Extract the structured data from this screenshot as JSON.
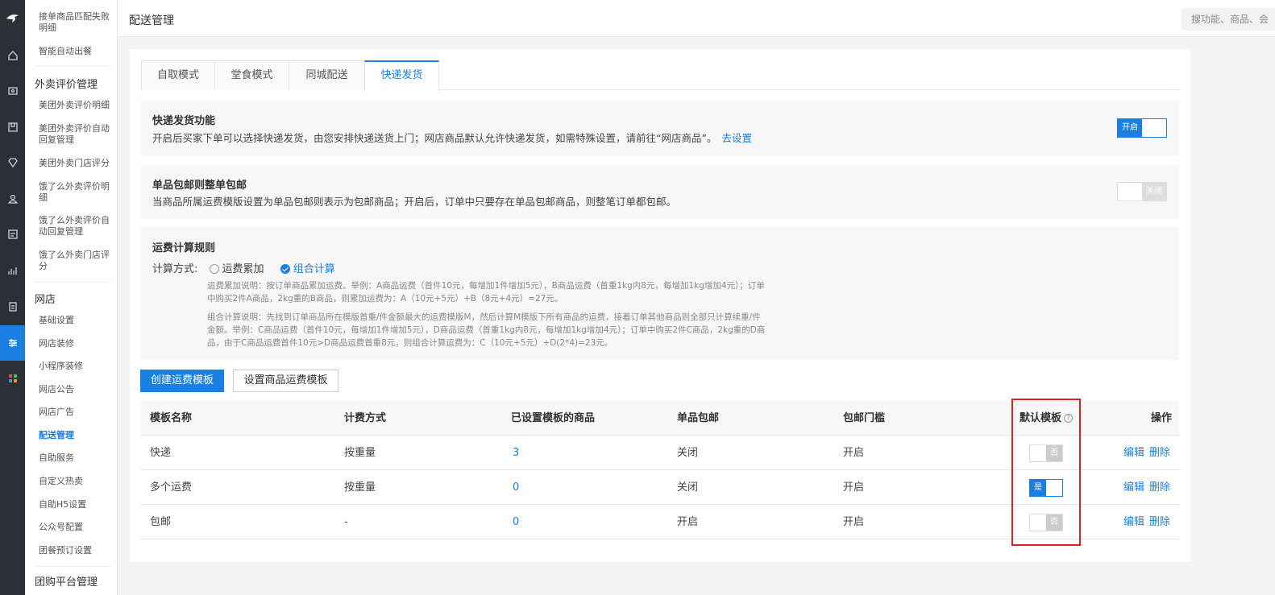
{
  "rail": {
    "items": [
      "home-icon",
      "shop-icon",
      "bag-icon",
      "diamond-icon",
      "people-icon",
      "card-icon",
      "chart-icon",
      "doc-icon",
      "sliders-icon",
      "apps-icon"
    ]
  },
  "sidebar": {
    "items_top": [
      {
        "label": "接单商品匹配失败明细"
      },
      {
        "label": "智能自动出餐"
      }
    ],
    "group1_title": "外卖评价管理",
    "group1_items": [
      {
        "label": "美团外卖评价明细"
      },
      {
        "label": "美团外卖评价自动回复管理"
      },
      {
        "label": "美团外卖门店评分"
      },
      {
        "label": "饿了么外卖评价明细"
      },
      {
        "label": "饿了么外卖评价自动回复管理"
      },
      {
        "label": "饿了么外卖门店评分"
      }
    ],
    "group2_title": "网店",
    "group2_items": [
      {
        "label": "基础设置"
      },
      {
        "label": "网店装修"
      },
      {
        "label": "小程序装修"
      },
      {
        "label": "网店公告"
      },
      {
        "label": "网店广告"
      },
      {
        "label": "配送管理"
      },
      {
        "label": "自助服务"
      },
      {
        "label": "自定义热卖"
      },
      {
        "label": "自助H5设置"
      },
      {
        "label": "公众号配置"
      },
      {
        "label": "团餐预订设置"
      }
    ],
    "group3_title": "团购平台管理"
  },
  "topbar": {
    "title": "配送管理",
    "search_placeholder": "搜功能、商品、会"
  },
  "tabs": [
    "自取模式",
    "堂食模式",
    "同城配送",
    "快递发货"
  ],
  "express": {
    "title": "快递发货功能",
    "desc": "开启后买家下单可以选择快递发货，由您安排快递送货上门；网店商品默认允许快递发货，如需特殊设置，请前往“网店商品”。",
    "link": "去设置",
    "toggle_label": "开启"
  },
  "single_free": {
    "title": "单品包邮则整单包邮",
    "desc": "当商品所属运费模版设置为单品包邮则表示为包邮商品；开启后，订单中只要存在单品包邮商品，则整笔订单都包邮。",
    "toggle_label": "关闭"
  },
  "rules": {
    "title": "运费计算规则",
    "method_label": "计算方式:",
    "option1": "运费累加",
    "option2": "组合计算",
    "note1_line1": "运费累加说明：按订单商品累加运费。举例：A商品运费（首件10元，每增加1件增加5元），B商品运费（首重1kg内8元，每增加1kg增加4元）；订单",
    "note1_line2": "中购买2件A商品，2kg重的B商品，则累加运费为：A（10元+5元）+B（8元+4元）=27元。",
    "note2_line1": "组合计算说明：先找到订单商品所在模版首重/件金额最大的运费模版M，然后计算M模版下所有商品的运费，接着订单其他商品则全部只计算续重/件",
    "note2_line2": "金额。举例：C商品运费（首件10元，每增加1件增加5元），D商品运费（首重1kg内8元，每增加1kg增加4元）；订单中购买2件C商品，2kg重的D商",
    "note2_line3": "品，由于C商品运费首件10元>D商品运费首重8元，则组合计算运费为：C（10元+5元）+D(2*4)=23元。"
  },
  "buttons": {
    "create": "创建运费模板",
    "set_goods": "设置商品运费模板"
  },
  "table": {
    "headers": [
      "模板名称",
      "计费方式",
      "已设置模板的商品",
      "单品包邮",
      "包邮门槛",
      "默认模板",
      "操作"
    ],
    "help": "?",
    "rows": [
      {
        "name": "快递",
        "method": "按重量",
        "count": "3",
        "single": "关闭",
        "threshold": "开启",
        "default": "否",
        "edit": "编辑",
        "delete": "删除"
      },
      {
        "name": "多个运费",
        "method": "按重量",
        "count": "0",
        "single": "关闭",
        "threshold": "开启",
        "default": "是",
        "edit": "编辑",
        "delete": "删除"
      },
      {
        "name": "包邮",
        "method": "-",
        "count": "0",
        "single": "开启",
        "threshold": "开启",
        "default": "否",
        "edit": "编辑",
        "delete": "删除"
      }
    ]
  },
  "colors": {
    "accent": "#1a7fe0",
    "highlight": "#e02020",
    "rail": "#2b2f36"
  }
}
